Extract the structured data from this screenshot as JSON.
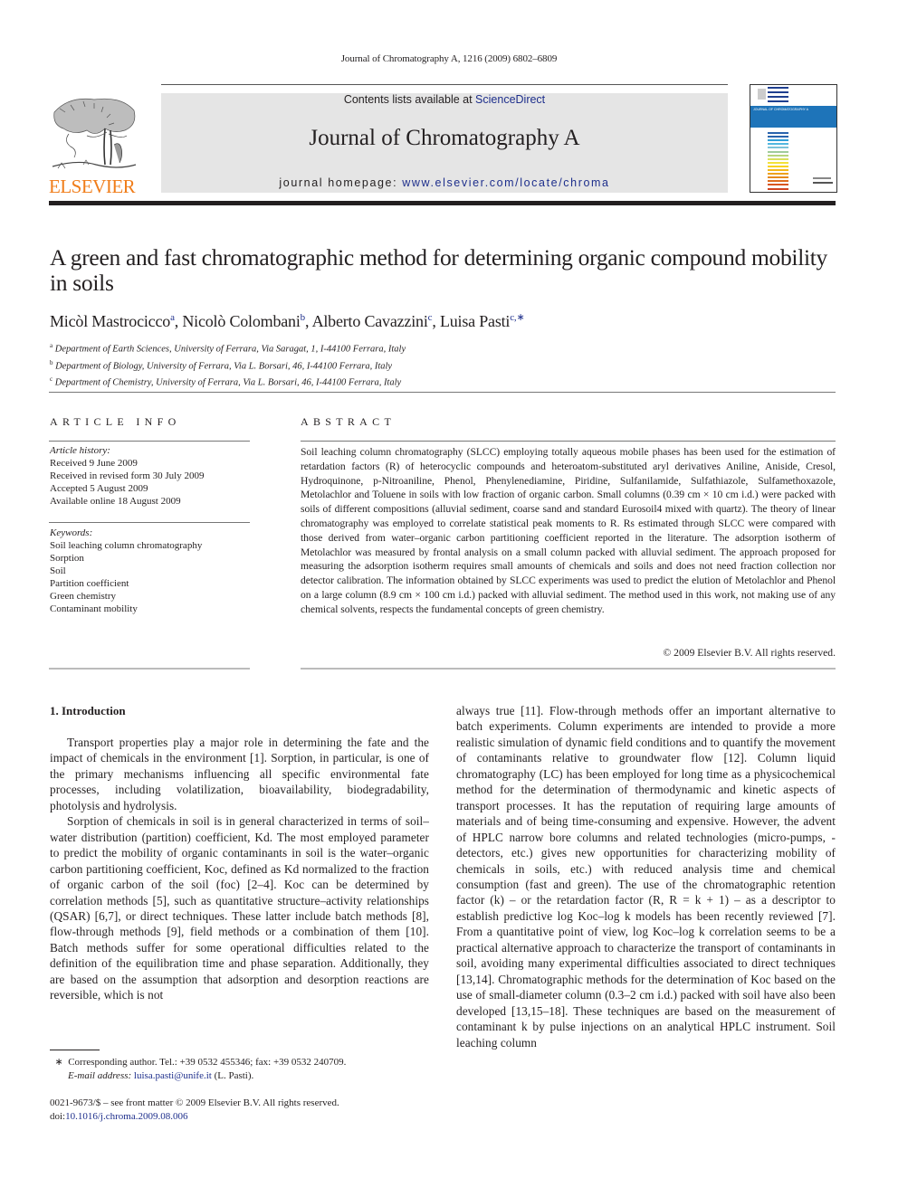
{
  "running_head": "Journal of Chromatography A, 1216 (2009) 6802–6809",
  "header": {
    "publisher_wordmark": "ELSEVIER",
    "contents_prefix": "Contents lists available at ",
    "contents_link": "ScienceDirect",
    "journal_title": "Journal of Chromatography A",
    "homepage_prefix": "journal homepage: ",
    "homepage_link": "www.elsevier.com/locate/chroma",
    "cover_title": "JOURNAL OF CHROMATOGRAPHY A",
    "cover_stripe_colors": [
      "#1f3f8f",
      "#1f3f8f",
      "#1f3f8f",
      "#1f3f8f",
      "#2a64ad",
      "#2a64ad",
      "#31a0d8",
      "#52b7e0",
      "#7cc3d9",
      "#9fcb9a",
      "#b7d47e",
      "#d8df5c",
      "#f2e23a",
      "#f8d21e",
      "#f4b81a",
      "#eea21c",
      "#e58a1d",
      "#de6d1f",
      "#d95620",
      "#cf4320"
    ]
  },
  "article": {
    "title": "A green and fast chromatographic method for determining organic compound mobility in soils",
    "authors": [
      {
        "name": "Micòl Mastrocicco",
        "aff": "a"
      },
      {
        "name": "Nicolò Colombani",
        "aff": "b"
      },
      {
        "name": "Alberto Cavazzini",
        "aff": "c"
      },
      {
        "name": "Luisa Pasti",
        "aff": "c,∗"
      }
    ],
    "affiliations": [
      {
        "key": "a",
        "text": "Department of Earth Sciences, University of Ferrara, Via Saragat, 1, I-44100 Ferrara, Italy"
      },
      {
        "key": "b",
        "text": "Department of Biology, University of Ferrara, Via L. Borsari, 46, I-44100 Ferrara, Italy"
      },
      {
        "key": "c",
        "text": "Department of Chemistry, University of Ferrara, Via L. Borsari, 46, I-44100 Ferrara, Italy"
      }
    ]
  },
  "article_info": {
    "heading": "ARTICLE INFO",
    "history_label": "Article history:",
    "history": [
      "Received 9 June 2009",
      "Received in revised form 30 July 2009",
      "Accepted 5 August 2009",
      "Available online 18 August 2009"
    ],
    "keywords_label": "Keywords:",
    "keywords": [
      "Soil leaching column chromatography",
      "Sorption",
      "Soil",
      "Partition coefficient",
      "Green chemistry",
      "Contaminant mobility"
    ]
  },
  "abstract": {
    "heading": "ABSTRACT",
    "text": "Soil leaching column chromatography (SLCC) employing totally aqueous mobile phases has been used for the estimation of retardation factors (R) of heterocyclic compounds and heteroatom-substituted aryl derivatives Aniline, Aniside, Cresol, Hydroquinone, p-Nitroaniline, Phenol, Phenylenediamine, Piridine, Sulfanilamide, Sulfathiazole, Sulfamethoxazole, Metolachlor and Toluene in soils with low fraction of organic carbon. Small columns (0.39 cm × 10 cm i.d.) were packed with soils of different compositions (alluvial sediment, coarse sand and standard Eurosoil4 mixed with quartz). The theory of linear chromatography was employed to correlate statistical peak moments to R. Rs estimated through SLCC were compared with those derived from water–organic carbon partitioning coefficient reported in the literature. The adsorption isotherm of Metolachlor was measured by frontal analysis on a small column packed with alluvial sediment. The approach proposed for measuring the adsorption isotherm requires small amounts of chemicals and soils and does not need fraction collection nor detector calibration. The information obtained by SLCC experiments was used to predict the elution of Metolachlor and Phenol on a large column (8.9 cm × 100 cm i.d.) packed with alluvial sediment. The method used in this work, not making use of any chemical solvents, respects the fundamental concepts of green chemistry.",
    "copyright": "© 2009 Elsevier B.V. All rights reserved."
  },
  "intro": {
    "heading": "1.  Introduction",
    "left_paragraphs": [
      "Transport properties play a major role in determining the fate and the impact of chemicals in the environment [1]. Sorption, in particular, is one of the primary mechanisms influencing all specific environmental fate processes, including volatilization, bioavailability, biodegradability, photolysis and hydrolysis.",
      "Sorption of chemicals in soil is in general characterized in terms of soil–water distribution (partition) coefficient, Kd. The most employed parameter to predict the mobility of organic contaminants in soil is the water–organic carbon partitioning coefficient, Koc, defined as Kd normalized to the fraction of organic carbon of the soil (foc) [2–4]. Koc can be determined by correlation methods [5], such as quantitative structure–activity relationships (QSAR) [6,7], or direct techniques. These latter include batch methods [8], flow-through methods [9], field methods or a combination of them [10]. Batch methods suffer for some operational difficulties related to the definition of the equilibration time and phase separation. Additionally, they are based on the assumption that adsorption and desorption reactions are reversible, which is not"
    ],
    "right_text": "always true [11]. Flow-through methods offer an important alternative to batch experiments. Column experiments are intended to provide a more realistic simulation of dynamic field conditions and to quantify the movement of contaminants relative to groundwater flow [12]. Column liquid chromatography (LC) has been employed for long time as a physicochemical method for the determination of thermodynamic and kinetic aspects of transport processes. It has the reputation of requiring large amounts of materials and of being time-consuming and expensive. However, the advent of HPLC narrow bore columns and related technologies (micro-pumps, -detectors, etc.) gives new opportunities for characterizing mobility of chemicals in soils, etc.) with reduced analysis time and chemical consumption (fast and green). The use of the chromatographic retention factor (k) – or the retardation factor (R, R = k + 1) – as a descriptor to establish predictive log Koc–log k models has been recently reviewed [7]. From a quantitative point of view, log Koc–log k correlation seems to be a practical alternative approach to characterize the transport of contaminants in soil, avoiding many experimental difficulties associated to direct techniques [13,14]. Chromatographic methods for the determination of Koc based on the use of small-diameter column (0.3–2 cm i.d.) packed with soil have also been developed [13,15–18]. These techniques are based on the measurement of contaminant k by pulse injections on an analytical HPLC instrument. Soil leaching column"
  },
  "footnote": {
    "marker": "∗",
    "corresponding": "Corresponding author. Tel.: +39 0532 455346; fax: +39 0532 240709.",
    "email_label": "E-mail address:",
    "email": "luisa.pasti@unife.it",
    "email_suffix": " (L. Pasti)."
  },
  "front_matter": {
    "issn_line": "0021-9673/$ – see front matter © 2009 Elsevier B.V. All rights reserved.",
    "doi_prefix": "doi:",
    "doi": "10.1016/j.chroma.2009.08.006"
  },
  "colors": {
    "link": "#1e2f8c",
    "elsevier_orange": "#f07d1a",
    "banner_bg": "#e5e5e5",
    "cover_band": "#1e74b9"
  }
}
